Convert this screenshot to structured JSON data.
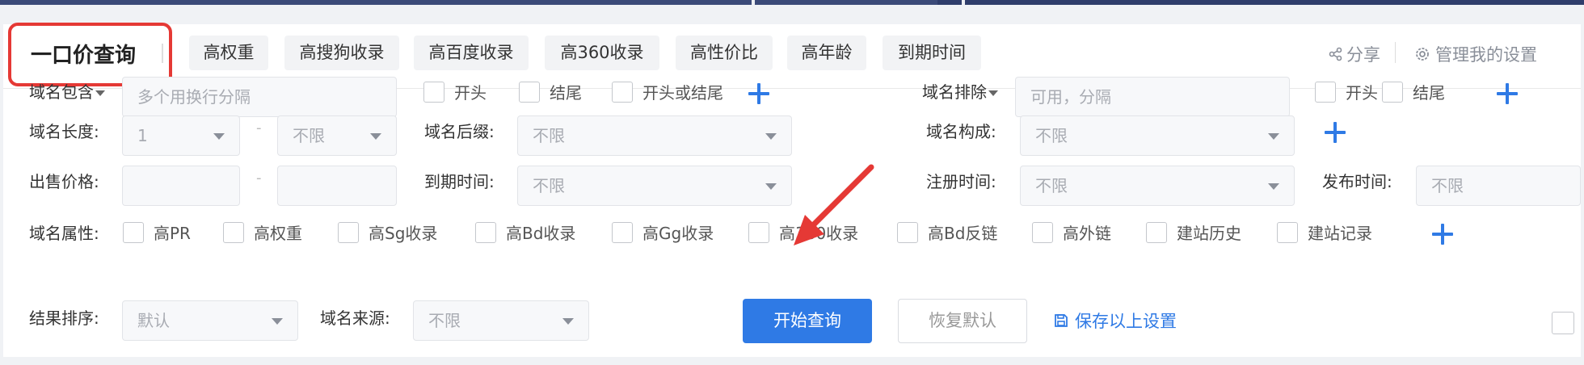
{
  "header": {
    "title": "一口价查询",
    "quick_tabs": [
      "高权重",
      "高搜狗收录",
      "高百度收录",
      "高360收录",
      "高性价比",
      "高年龄",
      "到期时间"
    ],
    "share_label": "分享",
    "settings_label": "管理我的设置"
  },
  "row1": {
    "include_label": "域名包含",
    "include_placeholder": "多个用换行分隔",
    "include_options": [
      "开头",
      "结尾",
      "开头或结尾"
    ],
    "exclude_label": "域名排除",
    "exclude_placeholder": "可用，分隔",
    "exclude_options": [
      "开头",
      "结尾"
    ]
  },
  "row2": {
    "length_label": "域名长度:",
    "length_min": "1",
    "length_dash": "-",
    "length_max": "不限",
    "suffix_label": "域名后缀:",
    "suffix_value": "不限",
    "compose_label": "域名构成:",
    "compose_value": "不限"
  },
  "row3": {
    "price_label": "出售价格:",
    "price_dash": "-",
    "expire_label": "到期时间:",
    "expire_value": "不限",
    "register_label": "注册时间:",
    "register_value": "不限",
    "publish_label": "发布时间:",
    "publish_value": "不限"
  },
  "row4": {
    "attr_label": "域名属性:",
    "attrs": [
      "高PR",
      "高权重",
      "高Sg收录",
      "高Bd收录",
      "高Gg收录",
      "高360收录",
      "高Bd反链",
      "高外链",
      "建站历史",
      "建站记录"
    ]
  },
  "row5": {
    "sort_label": "结果排序:",
    "sort_value": "默认",
    "source_label": "域名来源:",
    "source_value": "不限",
    "search_button": "开始查询",
    "reset_button": "恢复默认",
    "save_link": "保存以上设置"
  },
  "colors": {
    "accent": "#2f7ae5",
    "highlight_box": "#e53935",
    "annotation_arrow": "#e53935"
  },
  "icons": [
    "share-icon",
    "gear-icon",
    "save-icon",
    "plus-icon",
    "caret-down-icon",
    "red-annotation-arrow"
  ]
}
